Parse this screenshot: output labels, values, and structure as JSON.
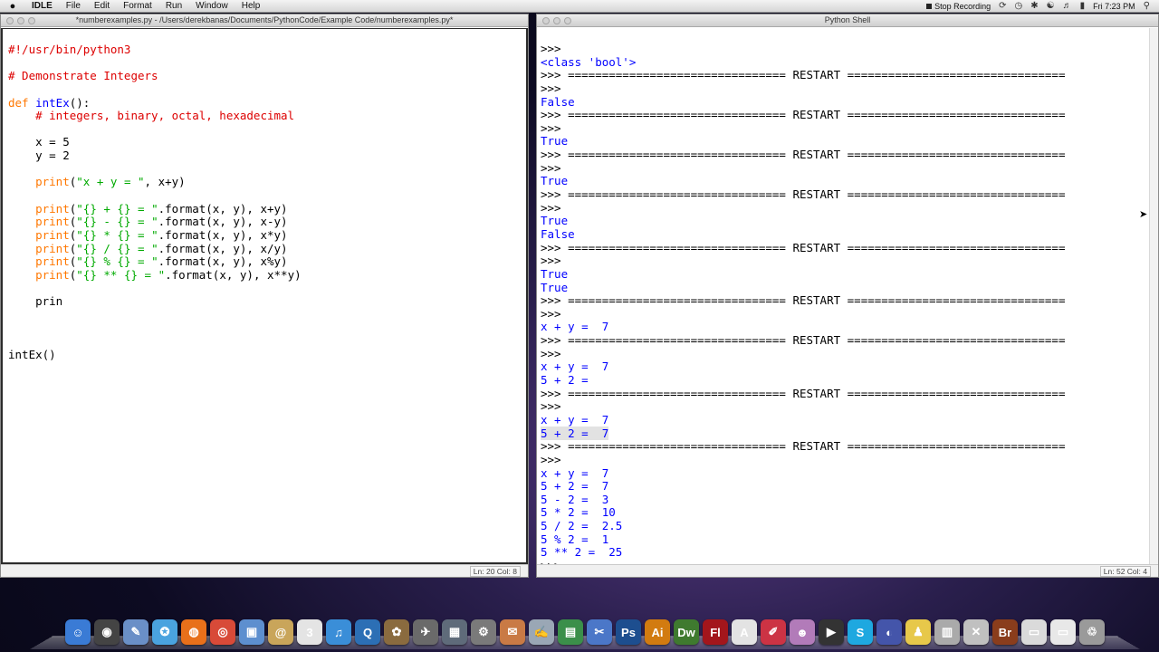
{
  "menubar": {
    "apple": "",
    "items": [
      "IDLE",
      "File",
      "Edit",
      "Format",
      "Run",
      "Window",
      "Help"
    ],
    "recording": "Stop Recording",
    "clock": "Fri 7:23 PM"
  },
  "editor": {
    "title": "*numberexamples.py - /Users/derekbanas/Documents/PythonCode/Example Code/numberexamples.py*",
    "status": "Ln: 20 Col: 8",
    "lines": [
      [
        {
          "t": "#!/usr/bin/python3",
          "c": "cm"
        }
      ],
      [],
      [
        {
          "t": "# Demonstrate Integers",
          "c": "cm"
        }
      ],
      [],
      [
        {
          "t": "def",
          "c": "kw"
        },
        {
          "t": " "
        },
        {
          "t": "intEx",
          "c": "fn"
        },
        {
          "t": "():"
        }
      ],
      [
        {
          "t": "    "
        },
        {
          "t": "# integers, binary, octal, hexadecimal",
          "c": "cm"
        }
      ],
      [],
      [
        {
          "t": "    x = 5"
        }
      ],
      [
        {
          "t": "    y = 2"
        }
      ],
      [],
      [
        {
          "t": "    "
        },
        {
          "t": "print",
          "c": "kw"
        },
        {
          "t": "("
        },
        {
          "t": "\"x + y = \"",
          "c": "str"
        },
        {
          "t": ", x+y)"
        }
      ],
      [],
      [
        {
          "t": "    "
        },
        {
          "t": "print",
          "c": "kw"
        },
        {
          "t": "("
        },
        {
          "t": "\"{} + {} = \"",
          "c": "str"
        },
        {
          "t": ".format(x, y), x+y)"
        }
      ],
      [
        {
          "t": "    "
        },
        {
          "t": "print",
          "c": "kw"
        },
        {
          "t": "("
        },
        {
          "t": "\"{} - {} = \"",
          "c": "str"
        },
        {
          "t": ".format(x, y), x-y)"
        }
      ],
      [
        {
          "t": "    "
        },
        {
          "t": "print",
          "c": "kw"
        },
        {
          "t": "("
        },
        {
          "t": "\"{} * {} = \"",
          "c": "str"
        },
        {
          "t": ".format(x, y), x*y)"
        }
      ],
      [
        {
          "t": "    "
        },
        {
          "t": "print",
          "c": "kw"
        },
        {
          "t": "("
        },
        {
          "t": "\"{} / {} = \"",
          "c": "str"
        },
        {
          "t": ".format(x, y), x/y)"
        }
      ],
      [
        {
          "t": "    "
        },
        {
          "t": "print",
          "c": "kw"
        },
        {
          "t": "("
        },
        {
          "t": "\"{} % {} = \"",
          "c": "str"
        },
        {
          "t": ".format(x, y), x%y)"
        }
      ],
      [
        {
          "t": "    "
        },
        {
          "t": "print",
          "c": "kw"
        },
        {
          "t": "("
        },
        {
          "t": "\"{} ** {} = \"",
          "c": "str"
        },
        {
          "t": ".format(x, y), x**y)"
        }
      ],
      [],
      [
        {
          "t": "    prin"
        }
      ],
      [],
      [],
      [],
      [
        {
          "t": "intEx()"
        }
      ]
    ]
  },
  "shell": {
    "title": "Python Shell",
    "status": "Ln: 52 Col: 4",
    "lines": [
      [
        {
          "t": ">>>"
        }
      ],
      [
        {
          "t": "<class 'bool'>",
          "c": "out"
        }
      ],
      [
        {
          "t": ">>> ================================ RESTART ================================"
        }
      ],
      [
        {
          "t": ">>>"
        }
      ],
      [
        {
          "t": "False",
          "c": "out"
        }
      ],
      [
        {
          "t": ">>> ================================ RESTART ================================"
        }
      ],
      [
        {
          "t": ">>>"
        }
      ],
      [
        {
          "t": "True",
          "c": "out"
        }
      ],
      [
        {
          "t": ">>> ================================ RESTART ================================"
        }
      ],
      [
        {
          "t": ">>>"
        }
      ],
      [
        {
          "t": "True",
          "c": "out"
        }
      ],
      [
        {
          "t": ">>> ================================ RESTART ================================"
        }
      ],
      [
        {
          "t": ">>>"
        }
      ],
      [
        {
          "t": "True",
          "c": "out"
        }
      ],
      [
        {
          "t": "False",
          "c": "out"
        }
      ],
      [
        {
          "t": ">>> ================================ RESTART ================================"
        }
      ],
      [
        {
          "t": ">>>"
        }
      ],
      [
        {
          "t": "True",
          "c": "out"
        }
      ],
      [
        {
          "t": "True",
          "c": "out"
        }
      ],
      [
        {
          "t": ">>> ================================ RESTART ================================"
        }
      ],
      [
        {
          "t": ">>>"
        }
      ],
      [
        {
          "t": "x + y =  7",
          "c": "out"
        }
      ],
      [
        {
          "t": ">>> ================================ RESTART ================================"
        }
      ],
      [
        {
          "t": ">>>"
        }
      ],
      [
        {
          "t": "x + y =  7",
          "c": "out"
        }
      ],
      [
        {
          "t": "5 + 2 = ",
          "c": "out"
        }
      ],
      [
        {
          "t": ">>> ================================ RESTART ================================"
        }
      ],
      [
        {
          "t": ">>>"
        }
      ],
      [
        {
          "t": "x + y =  7",
          "c": "out"
        }
      ],
      [
        {
          "t": "5 + 2 =  7",
          "c": "out hl"
        }
      ],
      [
        {
          "t": ">>> ================================ RESTART ================================"
        }
      ],
      [
        {
          "t": ">>>"
        }
      ],
      [
        {
          "t": "x + y =  7",
          "c": "out"
        }
      ],
      [
        {
          "t": "5 + 2 =  7",
          "c": "out"
        }
      ],
      [
        {
          "t": "5 - 2 =  3",
          "c": "out"
        }
      ],
      [
        {
          "t": "5 * 2 =  10",
          "c": "out"
        }
      ],
      [
        {
          "t": "5 / 2 =  2.5",
          "c": "out"
        }
      ],
      [
        {
          "t": "5 % 2 =  1",
          "c": "out"
        }
      ],
      [
        {
          "t": "5 ** 2 =  25",
          "c": "out"
        }
      ],
      [
        {
          "t": ">>>"
        }
      ]
    ]
  },
  "dock": {
    "apps": [
      {
        "icon": "finder-icon",
        "glyph": "☺",
        "color": "#3a7bd5"
      },
      {
        "icon": "dashboard-icon",
        "glyph": "◉",
        "color": "#444444"
      },
      {
        "icon": "preview-icon",
        "glyph": "✎",
        "color": "#6a8fc7"
      },
      {
        "icon": "safari-icon",
        "glyph": "✪",
        "color": "#4aa3df"
      },
      {
        "icon": "firefox-icon",
        "glyph": "◍",
        "color": "#e8701a"
      },
      {
        "icon": "chrome-icon",
        "glyph": "◎",
        "color": "#d84a38"
      },
      {
        "icon": "facetime-icon",
        "glyph": "▣",
        "color": "#5d8fcf"
      },
      {
        "icon": "contacts-icon",
        "glyph": "@",
        "color": "#c9a55a"
      },
      {
        "icon": "calendar-icon",
        "glyph": "3",
        "color": "#e4e4e4"
      },
      {
        "icon": "itunes-icon",
        "glyph": "♫",
        "color": "#3a8ed8"
      },
      {
        "icon": "quicktime-icon",
        "glyph": "Q",
        "color": "#2c6fb5"
      },
      {
        "icon": "iphoto-icon",
        "glyph": "✿",
        "color": "#8a6b3f"
      },
      {
        "icon": "apps-icon",
        "glyph": "✈",
        "color": "#6a6a6a"
      },
      {
        "icon": "mission-control-icon",
        "glyph": "▦",
        "color": "#5f6b7a"
      },
      {
        "icon": "system-preferences-icon",
        "glyph": "⚙",
        "color": "#7a7a7a"
      },
      {
        "icon": "stickies-icon",
        "glyph": "✉",
        "color": "#c97a45"
      },
      {
        "icon": "textedit-icon",
        "glyph": "✍",
        "color": "#9aa7b5"
      },
      {
        "icon": "numbers-icon",
        "glyph": "▤",
        "color": "#3b8f4a"
      },
      {
        "icon": "xcode-icon",
        "glyph": "✂",
        "color": "#4b77c8"
      },
      {
        "icon": "photoshop-icon",
        "glyph": "Ps",
        "color": "#1d4e8f"
      },
      {
        "icon": "illustrator-icon",
        "glyph": "Ai",
        "color": "#d27b10"
      },
      {
        "icon": "dreamweaver-icon",
        "glyph": "Dw",
        "color": "#3f7a2f"
      },
      {
        "icon": "flash-icon",
        "glyph": "Fl",
        "color": "#a3161c"
      },
      {
        "icon": "acrobat-icon",
        "glyph": "A",
        "color": "#e3e3e3"
      },
      {
        "icon": "pages-icon",
        "glyph": "✐",
        "color": "#cc3344"
      },
      {
        "icon": "mascot-icon",
        "glyph": "☻",
        "color": "#b27bb9"
      },
      {
        "icon": "clapper-icon",
        "glyph": "▶",
        "color": "#333333"
      },
      {
        "icon": "skype-icon",
        "glyph": "S",
        "color": "#1ea8e0"
      },
      {
        "icon": "globe-icon",
        "glyph": "◐",
        "color": "#4455aa"
      },
      {
        "icon": "python-icon",
        "glyph": "♟",
        "color": "#e7c84a"
      },
      {
        "icon": "calculator-icon",
        "glyph": "▥",
        "color": "#aaaaaa"
      },
      {
        "icon": "utilities-icon",
        "glyph": "✕",
        "color": "#c0c0c0"
      },
      {
        "icon": "bridge-icon",
        "glyph": "Br",
        "color": "#8a3d1c"
      },
      {
        "icon": "documents-icon",
        "glyph": "▭",
        "color": "#dadada"
      },
      {
        "icon": "downloads-icon",
        "glyph": "▭",
        "color": "#e8e8e8"
      },
      {
        "icon": "trash-icon",
        "glyph": "♲",
        "color": "#9a9a9a"
      }
    ]
  }
}
